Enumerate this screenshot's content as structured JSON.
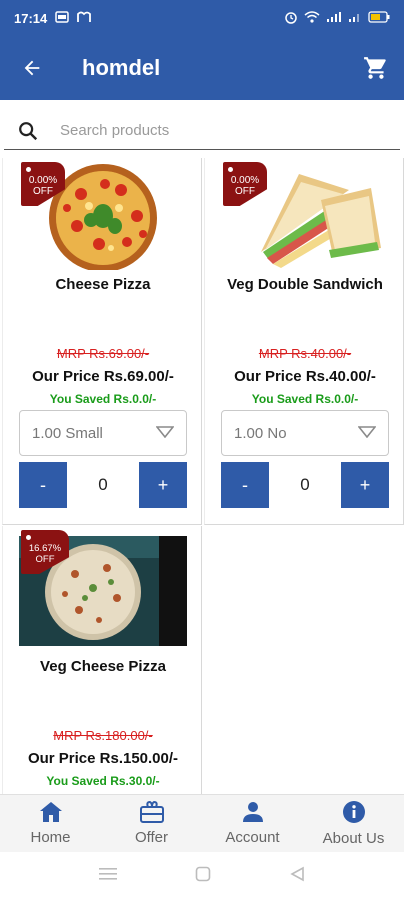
{
  "status": {
    "time": "17:14"
  },
  "appbar": {
    "title": "homdel"
  },
  "search": {
    "placeholder": "Search products"
  },
  "products": [
    {
      "name": "Cheese Pizza",
      "discount_line1": "0.00%",
      "discount_line2": "OFF",
      "mrp": "MRP Rs.69.00/-",
      "price": "Our Price Rs.69.00/-",
      "saved": "You Saved Rs.0.0/-",
      "variant": "1.00 Small",
      "qty": "0"
    },
    {
      "name": "Veg Double Sandwich",
      "discount_line1": "0.00%",
      "discount_line2": "OFF",
      "mrp": "MRP Rs.40.00/-",
      "price": "Our Price Rs.40.00/-",
      "saved": "You Saved Rs.0.0/-",
      "variant": "1.00 No",
      "qty": "0"
    },
    {
      "name": "Veg Cheese Pizza",
      "discount_line1": "16.67%",
      "discount_line2": "OFF",
      "mrp": "MRP Rs.180.00/-",
      "price": "Our Price Rs.150.00/-",
      "saved": "You Saved Rs.30.0/-"
    }
  ],
  "stepper": {
    "minus": "-",
    "plus": "+"
  },
  "bottom_nav": [
    {
      "label": "Home",
      "icon": "home-icon"
    },
    {
      "label": "Offer",
      "icon": "offer-icon"
    },
    {
      "label": "Account",
      "icon": "account-icon"
    },
    {
      "label": "About Us",
      "icon": "info-icon"
    }
  ],
  "colors": {
    "primary": "#2f5ba8",
    "badge": "#8b1212",
    "mrp": "#d82020",
    "saved": "#1a9c1a"
  }
}
